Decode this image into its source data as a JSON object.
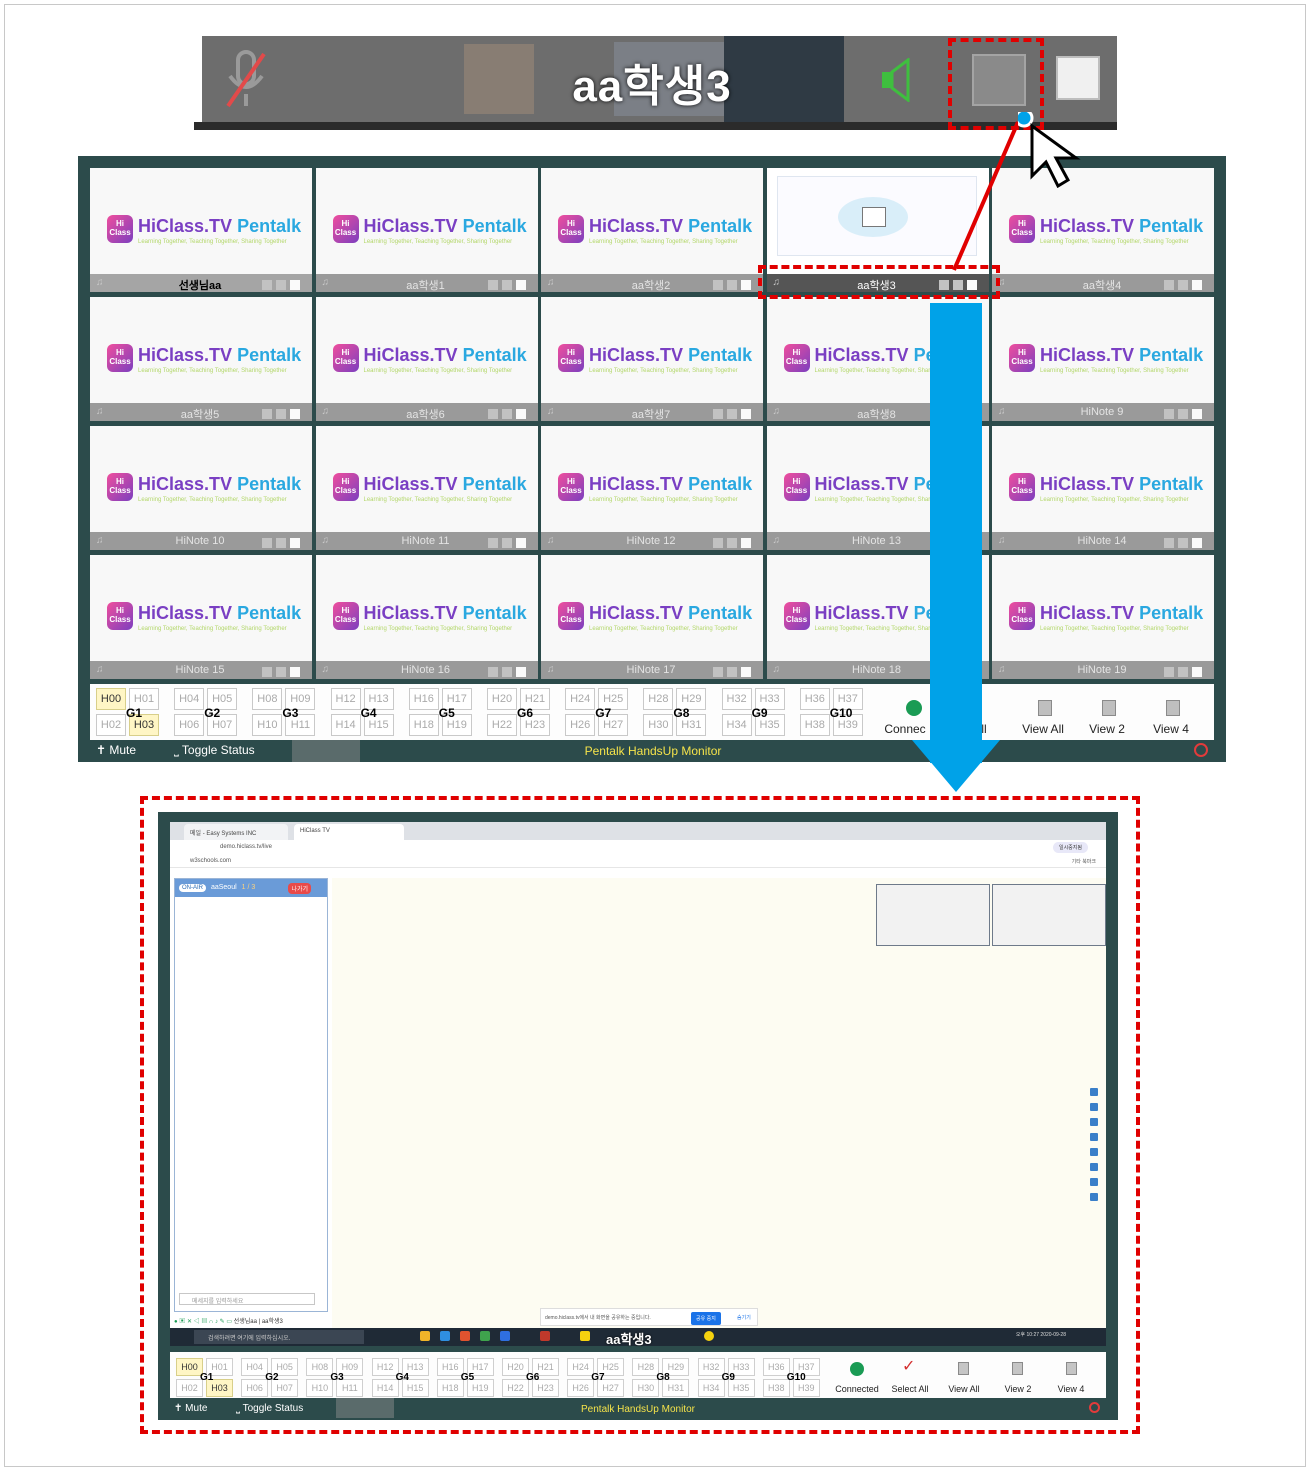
{
  "zoom": {
    "student_name": "aa학생3"
  },
  "tiles": [
    {
      "name": "선생님aa",
      "type": "logo"
    },
    {
      "name": "aa학생1",
      "type": "logo"
    },
    {
      "name": "aa학생2",
      "type": "logo"
    },
    {
      "name": "aa학생3",
      "type": "screen"
    },
    {
      "name": "aa학생4",
      "type": "logo"
    },
    {
      "name": "aa학생5",
      "type": "logo"
    },
    {
      "name": "aa학생6",
      "type": "logo"
    },
    {
      "name": "aa학생7",
      "type": "logo"
    },
    {
      "name": "aa학생8",
      "type": "logo"
    },
    {
      "name": "HiNote 9",
      "type": "logo"
    },
    {
      "name": "HiNote 10",
      "type": "logo"
    },
    {
      "name": "HiNote 11",
      "type": "logo"
    },
    {
      "name": "HiNote 12",
      "type": "logo"
    },
    {
      "name": "HiNote 13",
      "type": "logo"
    },
    {
      "name": "HiNote 14",
      "type": "logo"
    },
    {
      "name": "HiNote 15",
      "type": "logo"
    },
    {
      "name": "HiNote 16",
      "type": "logo"
    },
    {
      "name": "HiNote 17",
      "type": "logo"
    },
    {
      "name": "HiNote 18",
      "type": "logo"
    },
    {
      "name": "HiNote 19",
      "type": "logo"
    }
  ],
  "brand": {
    "name": "HiClass.TV",
    "product": "Pentalk",
    "tagline": "Learning Together, Teaching Together, Sharing Together",
    "logo_text": "Hi Class"
  },
  "groups": [
    "G1",
    "G2",
    "G3",
    "G4",
    "G5",
    "G6",
    "G7",
    "G8",
    "G9",
    "G10"
  ],
  "hand_buttons": [
    "H00",
    "H01",
    "H02",
    "H03",
    "H04",
    "H05",
    "H06",
    "H07",
    "H08",
    "H09",
    "H10",
    "H11",
    "H12",
    "H13",
    "H14",
    "H15",
    "H16",
    "H17",
    "H18",
    "H19",
    "H20",
    "H21",
    "H22",
    "H23",
    "H24",
    "H25",
    "H26",
    "H27",
    "H28",
    "H29",
    "H30",
    "H31",
    "H32",
    "H33",
    "H34",
    "H35",
    "H36",
    "H37",
    "H38",
    "H39"
  ],
  "active_hands": [
    "H00",
    "H03"
  ],
  "top_actions": {
    "connected": "Connec",
    "select_all": "All",
    "view_all": "View All",
    "view2": "View 2",
    "view4": "View 4"
  },
  "bottom_actions": {
    "connected": "Connected",
    "select_all": "Select All",
    "view_all": "View All",
    "view2": "View 2",
    "view4": "View 4"
  },
  "status": {
    "mute": "Mute",
    "toggle": "Toggle Status",
    "title": "Pentalk HandsUp Monitor"
  },
  "browser": {
    "tab1": "메일 - Easy Systems INC",
    "tab2": "HiClass TV",
    "url": "demo.hiclass.tv/live",
    "bookmark": "w3schools.com",
    "bookmark_right": "기타 북마크",
    "profile": "일시중지됨",
    "sidebar_onair": "ON-AIR",
    "sidebar_room": "aaSeoul",
    "sidebar_count": "1 / 3",
    "sidebar_out": "나가기",
    "message_placeholder": "메세지를 입력하세요",
    "tool_user": "선생님aa",
    "tool_user2": "aa학생3",
    "share_text": "demo.hiclass.tv에서 내 화면을 공유하는 중입니다.",
    "share_stop": "공유 중지",
    "share_hide": "숨기기",
    "taskbar_search": "검색하려면 여기에 입력하십시오.",
    "taskbar_name": "aa학생3",
    "clock": "오후 10:27 2020-09-28"
  },
  "colors": {
    "frame_bg": "#2c4b4b",
    "highlight": "#e00000",
    "arrow": "#00a2e8",
    "active_hand": "#fff6c5",
    "status_title": "#f5e34a",
    "connected_dot": "#1a9b54"
  }
}
